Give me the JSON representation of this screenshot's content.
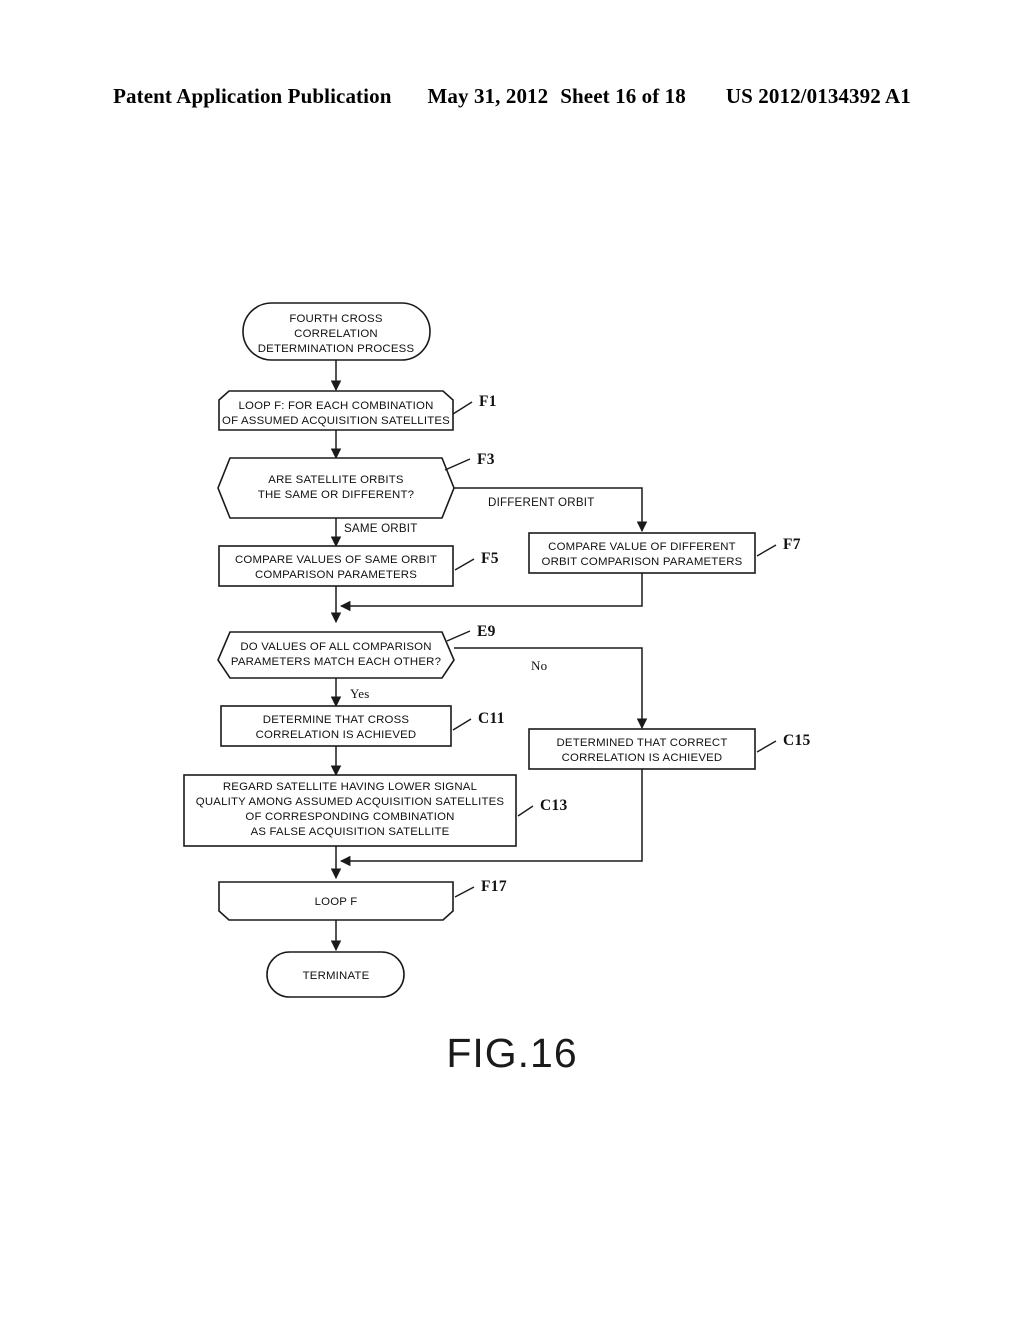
{
  "header": {
    "publication": "Patent Application Publication",
    "date": "May 31, 2012",
    "sheet": "Sheet 16 of 18",
    "number": "US 2012/0134392 A1"
  },
  "figure": {
    "caption": "FIG.16"
  },
  "flowchart": {
    "start": {
      "ref": "",
      "lines": [
        "FOURTH CROSS",
        "CORRELATION",
        "DETERMINATION PROCESS"
      ]
    },
    "loop_start": {
      "ref": "F1",
      "lines": [
        "LOOP F: FOR EACH COMBINATION",
        "OF ASSUMED ACQUISITION SATELLITES"
      ]
    },
    "decision_orbit": {
      "ref": "F3",
      "lines": [
        "ARE SATELLITE ORBITS",
        "THE SAME OR DIFFERENT?"
      ]
    },
    "branch_same": "SAME ORBIT",
    "branch_different": "DIFFERENT ORBIT",
    "compare_same": {
      "ref": "F5",
      "lines": [
        "COMPARE VALUES OF SAME ORBIT",
        "COMPARISON PARAMETERS"
      ]
    },
    "compare_different": {
      "ref": "F7",
      "lines": [
        "COMPARE VALUE OF DIFFERENT",
        "ORBIT COMPARISON PARAMETERS"
      ]
    },
    "decision_match": {
      "ref": "E9",
      "lines": [
        "DO VALUES OF ALL COMPARISON",
        "PARAMETERS MATCH EACH OTHER?"
      ]
    },
    "branch_yes": "Yes",
    "branch_no": "No",
    "cross_correlation": {
      "ref": "C11",
      "lines": [
        "DETERMINE THAT CROSS",
        "CORRELATION IS ACHIEVED"
      ]
    },
    "false_acquisition": {
      "ref": "C13",
      "lines": [
        "REGARD SATELLITE HAVING LOWER SIGNAL",
        "QUALITY AMONG ASSUMED ACQUISITION SATELLITES",
        "OF CORRESPONDING COMBINATION",
        "AS FALSE ACQUISITION SATELLITE"
      ]
    },
    "correct_correlation": {
      "ref": "C15",
      "lines": [
        "DETERMINED THAT CORRECT",
        "CORRELATION IS ACHIEVED"
      ]
    },
    "loop_end": {
      "ref": "F17",
      "lines": [
        "LOOP F"
      ]
    },
    "terminate": {
      "ref": "",
      "lines": [
        "TERMINATE"
      ]
    }
  }
}
